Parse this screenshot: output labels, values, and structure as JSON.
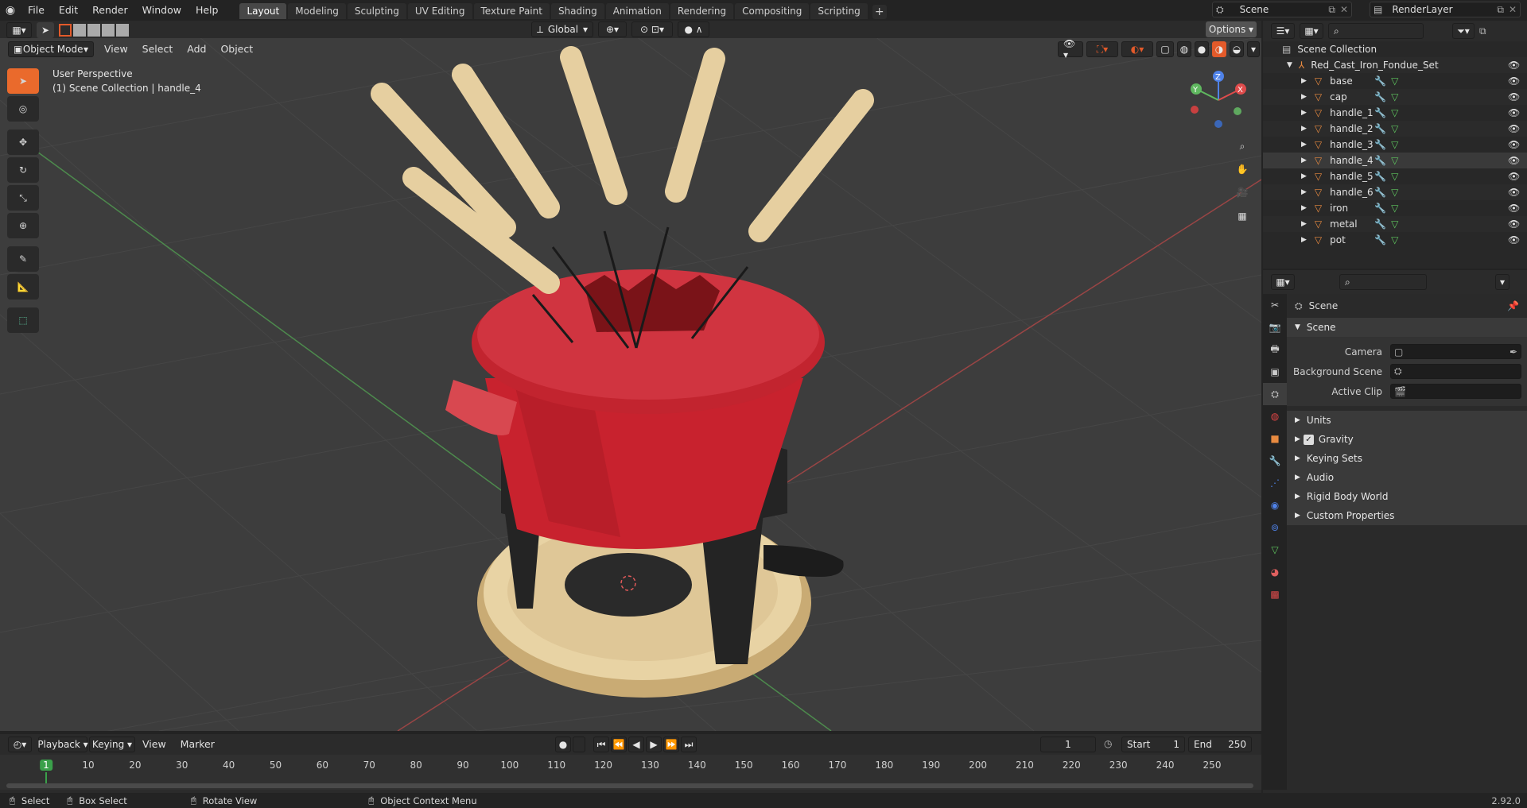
{
  "topbar": {
    "menus": [
      "File",
      "Edit",
      "Render",
      "Window",
      "Help"
    ],
    "workspaces": [
      "Layout",
      "Modeling",
      "Sculpting",
      "UV Editing",
      "Texture Paint",
      "Shading",
      "Animation",
      "Rendering",
      "Compositing",
      "Scripting"
    ],
    "active_workspace": "Layout",
    "scene_name": "Scene",
    "view_layer": "RenderLayer"
  },
  "viewport": {
    "mode": "Object Mode",
    "menus": [
      "View",
      "Select",
      "Add",
      "Object"
    ],
    "orientation": "Global",
    "options_label": "Options",
    "perspective_label": "User Perspective",
    "collection_label": "(1) Scene Collection | handle_4",
    "gizmo_axes": {
      "x": "X",
      "y": "Y",
      "z": "Z"
    }
  },
  "outliner": {
    "root": "Scene Collection",
    "collection": "Red_Cast_Iron_Fondue_Set",
    "items": [
      "base",
      "cap",
      "handle_1",
      "handle_2",
      "handle_3",
      "handle_4",
      "handle_5",
      "handle_6",
      "iron",
      "metal",
      "pot"
    ],
    "selected": "handle_4"
  },
  "properties": {
    "context": "Scene",
    "panel": "Scene",
    "fields": [
      {
        "label": "Camera",
        "value": ""
      },
      {
        "label": "Background Scene",
        "value": ""
      },
      {
        "label": "Active Clip",
        "value": ""
      }
    ],
    "sections": [
      "Units",
      "Gravity",
      "Keying Sets",
      "Audio",
      "Rigid Body World",
      "Custom Properties"
    ],
    "gravity_checked": true
  },
  "timeline": {
    "menus": [
      "Playback",
      "Keying",
      "View",
      "Marker"
    ],
    "current_frame": "1",
    "start_label": "Start",
    "start_value": "1",
    "end_label": "End",
    "end_value": "250",
    "ticks": [
      "1",
      "10",
      "20",
      "30",
      "40",
      "50",
      "60",
      "70",
      "80",
      "90",
      "100",
      "110",
      "120",
      "130",
      "140",
      "150",
      "160",
      "170",
      "180",
      "190",
      "200",
      "210",
      "220",
      "230",
      "240",
      "250"
    ]
  },
  "statusbar": {
    "select": "Select",
    "box_select": "Box Select",
    "rotate_view": "Rotate View",
    "context_menu": "Object Context Menu",
    "version": "2.92.0"
  },
  "colors": {
    "accent": "#ea6a2c",
    "pot_red": "#c8222e",
    "wood": "#e6cfa0",
    "frame_green": "#3aa04a"
  }
}
